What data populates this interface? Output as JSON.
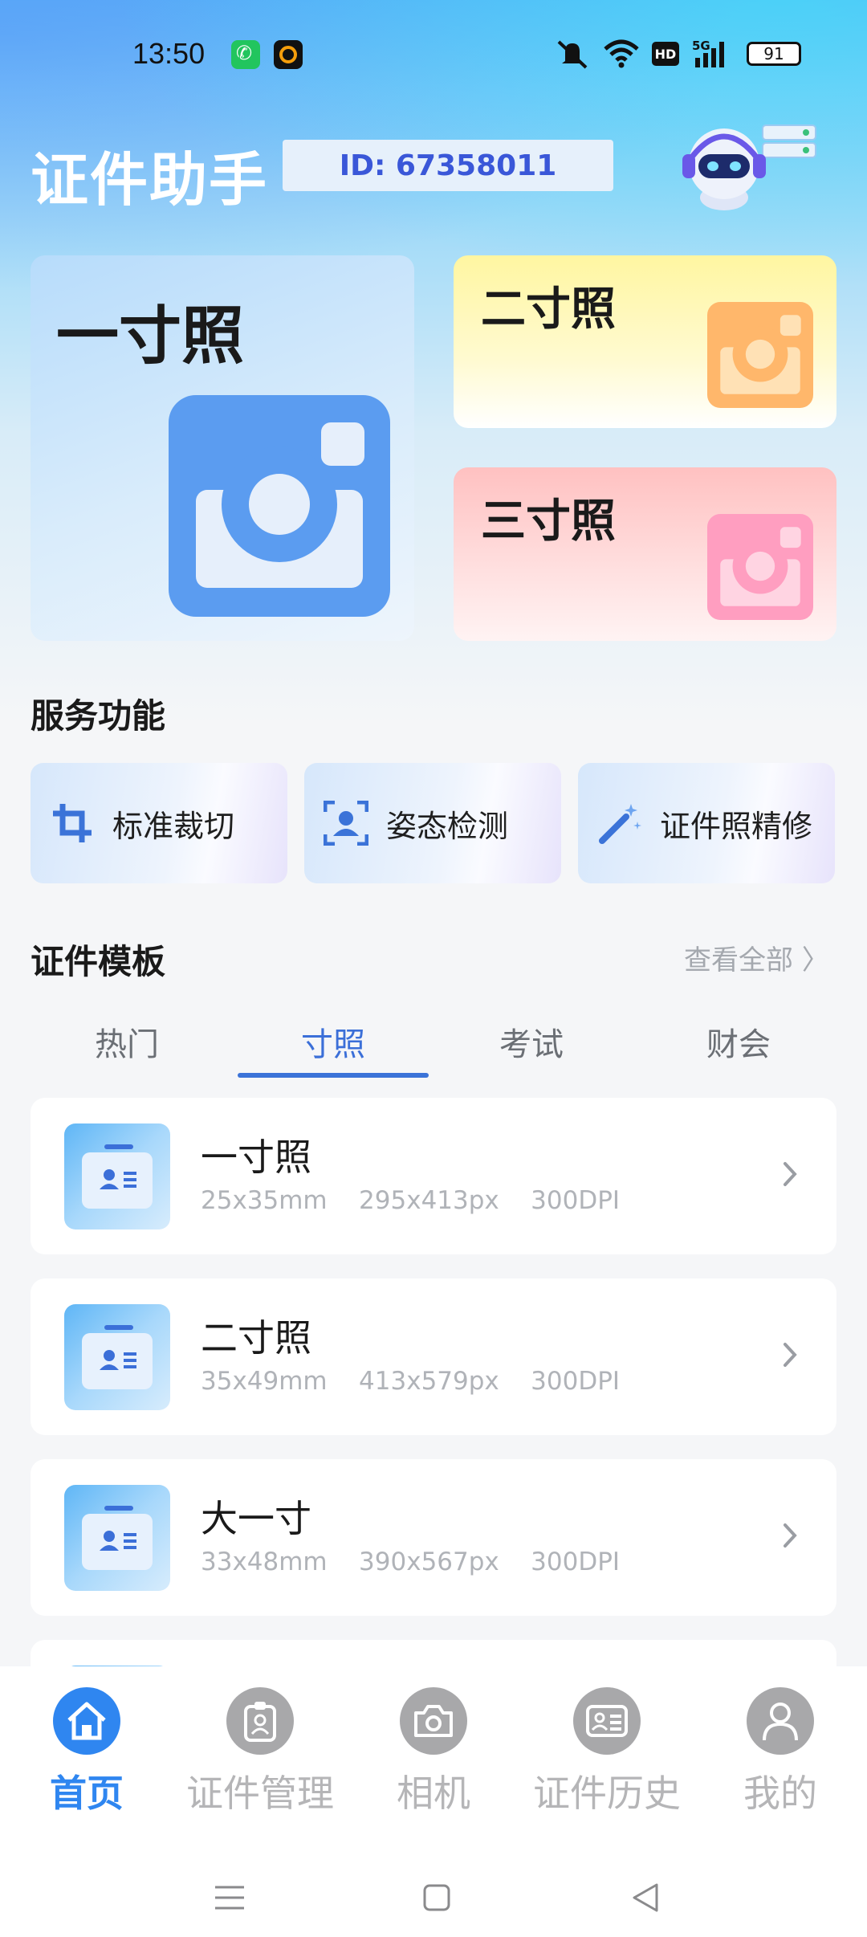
{
  "status_bar": {
    "time": "13:50",
    "network": "5G",
    "hd": "HD",
    "battery": "91"
  },
  "header": {
    "title": "证件助手",
    "user_id": "ID:  67358011"
  },
  "photo_cards": [
    {
      "label": "一寸照",
      "accent": "#5b9cf0"
    },
    {
      "label": "二寸照",
      "accent": "#ffb76b"
    },
    {
      "label": "三寸照",
      "accent": "#ff9ec0"
    }
  ],
  "services": {
    "title": "服务功能",
    "items": [
      {
        "label": "标准裁切",
        "icon": "crop-icon"
      },
      {
        "label": "姿态检测",
        "icon": "face-scan-icon"
      },
      {
        "label": "证件照精修",
        "icon": "magic-wand-icon"
      }
    ]
  },
  "templates": {
    "title": "证件模板",
    "see_all": "查看全部 〉",
    "tabs": [
      "热门",
      "寸照",
      "考试",
      "财会"
    ],
    "active_tab": "寸照",
    "items": [
      {
        "name": "一寸照",
        "specs": "25x35mm    295x413px    300DPI"
      },
      {
        "name": "二寸照",
        "specs": "35x49mm    413x579px    300DPI"
      },
      {
        "name": "大一寸",
        "specs": "33x48mm    390x567px    300DPI"
      }
    ]
  },
  "bottom_nav": {
    "items": [
      {
        "label": "首页",
        "icon": "home-icon"
      },
      {
        "label": "证件管理",
        "icon": "id-badge-icon"
      },
      {
        "label": "相机",
        "icon": "camera-icon"
      },
      {
        "label": "证件历史",
        "icon": "id-card-history-icon"
      },
      {
        "label": "我的",
        "icon": "user-icon"
      }
    ],
    "active": "首页"
  },
  "colors": {
    "primary": "#2f86f0",
    "tab_active": "#3b6fd8",
    "id_text": "#3a57d8"
  }
}
